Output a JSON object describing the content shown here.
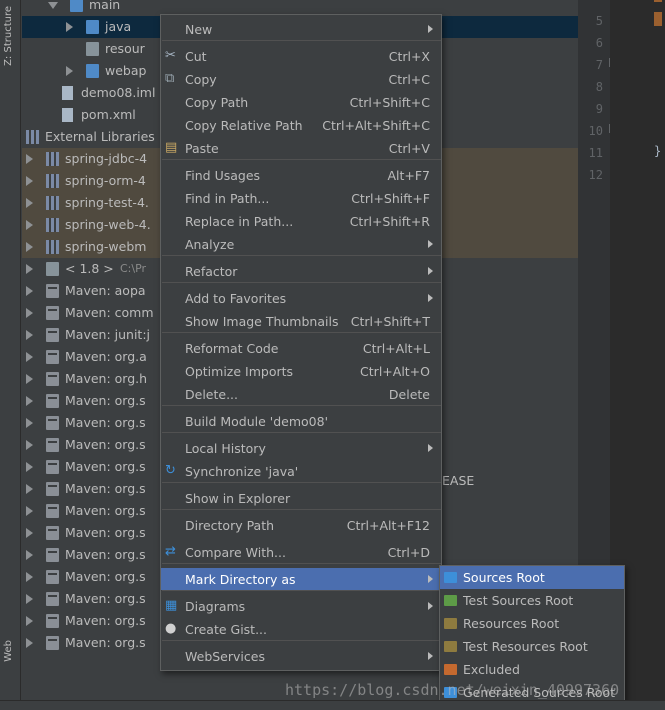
{
  "left_strip": {
    "structure_label": "Z: Structure",
    "web_label": "Web"
  },
  "tree": {
    "rows": [
      {
        "label": "main",
        "dim": ""
      },
      {
        "label": "java",
        "dim": ""
      },
      {
        "label": "resour",
        "dim": ""
      },
      {
        "label": "webap",
        "dim": ""
      },
      {
        "label": "demo08.iml",
        "dim": ""
      },
      {
        "label": "pom.xml",
        "dim": ""
      },
      {
        "label": "External Libraries",
        "dim": ""
      },
      {
        "label": "spring-jdbc-4",
        "dim": ""
      },
      {
        "label": "spring-orm-4",
        "dim": ""
      },
      {
        "label": "spring-test-4.",
        "dim": ""
      },
      {
        "label": "spring-web-4.",
        "dim": ""
      },
      {
        "label": "spring-webm",
        "dim": ""
      },
      {
        "label": "< 1.8 >",
        "dim": "C:\\Pr"
      },
      {
        "label": "Maven: aopa",
        "dim": ""
      },
      {
        "label": "Maven: comm",
        "dim": ""
      },
      {
        "label": "Maven: junit:j",
        "dim": ""
      },
      {
        "label": "Maven: org.a",
        "dim": ""
      },
      {
        "label": "Maven: org.h",
        "dim": ""
      },
      {
        "label": "Maven: org.s",
        "dim": ""
      },
      {
        "label": "Maven: org.s",
        "dim": ""
      },
      {
        "label": "Maven: org.s",
        "dim": ""
      },
      {
        "label": "Maven: org.s",
        "dim": ""
      },
      {
        "label": "Maven: org.s",
        "dim": ""
      },
      {
        "label": "Maven: org.s",
        "dim": ""
      },
      {
        "label": "Maven: org.s",
        "dim": ""
      },
      {
        "label": "Maven: org.s",
        "dim": ""
      },
      {
        "label": "Maven: org.s",
        "dim": ""
      },
      {
        "label": "Maven: org.s",
        "dim": ""
      },
      {
        "label": "Maven: org.s",
        "dim": ""
      },
      {
        "label": "Maven: org.s",
        "dim": ""
      }
    ],
    "ease_fragment": "EASE"
  },
  "gutter": {
    "lines": [
      "5",
      "6",
      "7",
      "8",
      "9",
      "10",
      "11",
      "12"
    ],
    "code_brace": "}"
  },
  "menu": {
    "items": [
      {
        "label": "New",
        "shortcut": "",
        "submenu": true
      },
      {
        "label": "Cut",
        "shortcut": "Ctrl+X",
        "submenu": false
      },
      {
        "label": "Copy",
        "shortcut": "Ctrl+C",
        "submenu": false
      },
      {
        "label": "Copy Path",
        "shortcut": "Ctrl+Shift+C",
        "submenu": false
      },
      {
        "label": "Copy Relative Path",
        "shortcut": "Ctrl+Alt+Shift+C",
        "submenu": false
      },
      {
        "label": "Paste",
        "shortcut": "Ctrl+V",
        "submenu": false
      },
      {
        "label": "Find Usages",
        "shortcut": "Alt+F7",
        "submenu": false
      },
      {
        "label": "Find in Path...",
        "shortcut": "Ctrl+Shift+F",
        "submenu": false
      },
      {
        "label": "Replace in Path...",
        "shortcut": "Ctrl+Shift+R",
        "submenu": false
      },
      {
        "label": "Analyze",
        "shortcut": "",
        "submenu": true
      },
      {
        "label": "Refactor",
        "shortcut": "",
        "submenu": true
      },
      {
        "label": "Add to Favorites",
        "shortcut": "",
        "submenu": true
      },
      {
        "label": "Show Image Thumbnails",
        "shortcut": "Ctrl+Shift+T",
        "submenu": false
      },
      {
        "label": "Reformat Code",
        "shortcut": "Ctrl+Alt+L",
        "submenu": false
      },
      {
        "label": "Optimize Imports",
        "shortcut": "Ctrl+Alt+O",
        "submenu": false
      },
      {
        "label": "Delete...",
        "shortcut": "Delete",
        "submenu": false
      },
      {
        "label": "Build Module 'demo08'",
        "shortcut": "",
        "submenu": false
      },
      {
        "label": "Local History",
        "shortcut": "",
        "submenu": true
      },
      {
        "label": "Synchronize 'java'",
        "shortcut": "",
        "submenu": false
      },
      {
        "label": "Show in Explorer",
        "shortcut": "",
        "submenu": false
      },
      {
        "label": "Directory Path",
        "shortcut": "Ctrl+Alt+F12",
        "submenu": false
      },
      {
        "label": "Compare With...",
        "shortcut": "Ctrl+D",
        "submenu": false
      },
      {
        "label": "Mark Directory as",
        "shortcut": "",
        "submenu": true
      },
      {
        "label": "Diagrams",
        "shortcut": "",
        "submenu": true
      },
      {
        "label": "Create Gist...",
        "shortcut": "",
        "submenu": false
      },
      {
        "label": "WebServices",
        "shortcut": "",
        "submenu": true
      }
    ],
    "active_item": "Mark Directory as"
  },
  "submenu": {
    "items": [
      {
        "label": "Sources Root",
        "color": "#3d8fd9"
      },
      {
        "label": "Test Sources Root",
        "color": "#5d9b47"
      },
      {
        "label": "Resources Root",
        "color": "#8e7b3f"
      },
      {
        "label": "Test Resources Root",
        "color": "#8e7b3f"
      },
      {
        "label": "Excluded",
        "color": "#c4692f"
      },
      {
        "label": "Generated Sources Root",
        "color": "#3d8fd9"
      }
    ],
    "active_item": "Sources Root"
  },
  "watermark": "https://blog.csdn.net/weixin_40997360",
  "colors": {
    "accent": "#4b6eaf",
    "background": "#3c3f41",
    "editor": "#2b2b2b"
  }
}
